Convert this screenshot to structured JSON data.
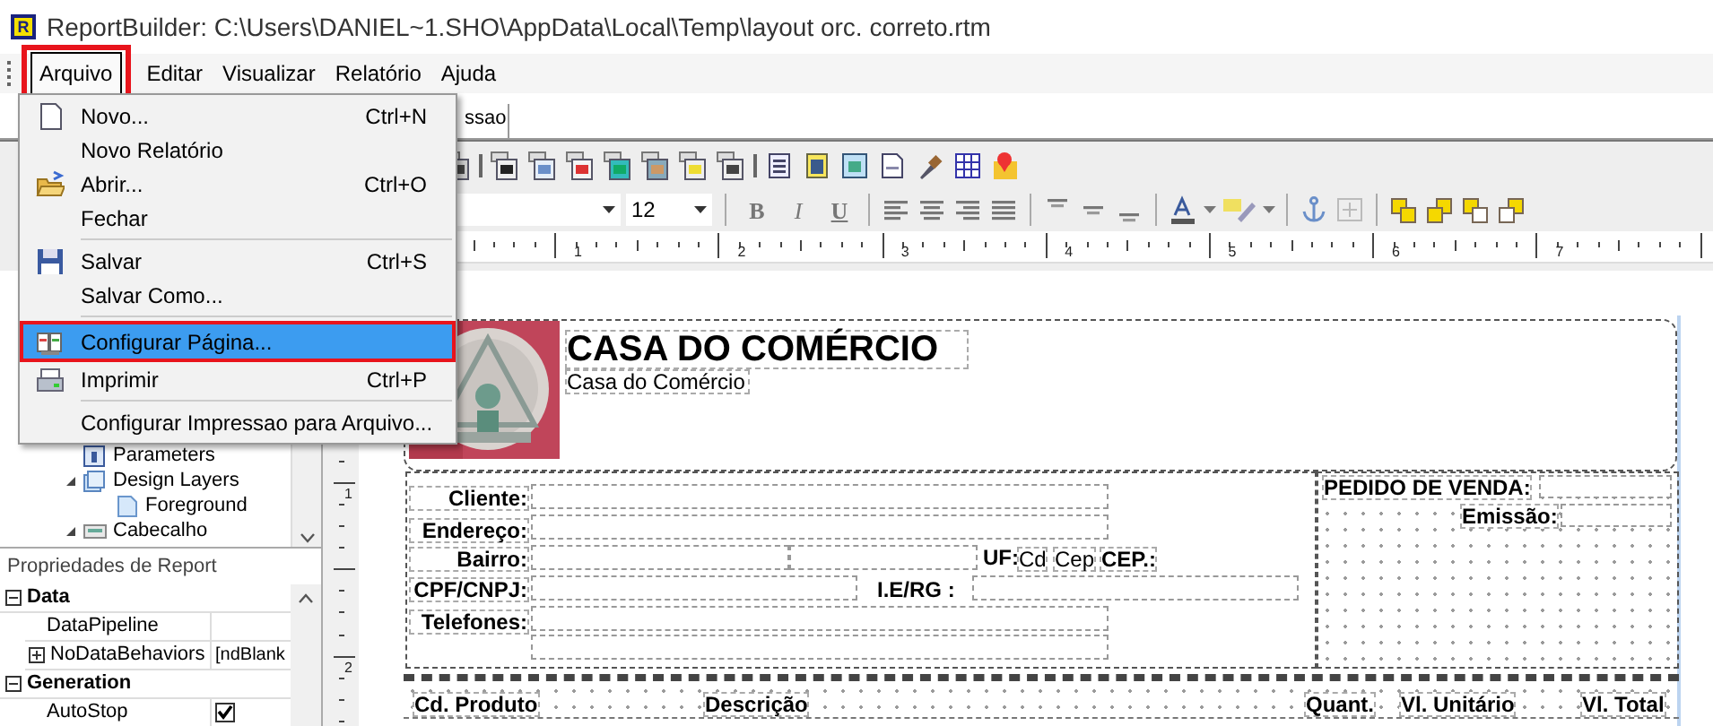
{
  "window": {
    "logo_letter": "R",
    "title": "ReportBuilder: C:\\Users\\DANIEL~1.SHO\\AppData\\Local\\Temp\\layout orc. correto.rtm"
  },
  "menu_bar": [
    {
      "label": "Arquivo",
      "selected": true,
      "outlined": true
    },
    {
      "label": "Editar",
      "selected": false,
      "outlined": false
    },
    {
      "label": "Visualizar",
      "selected": false,
      "outlined": false
    },
    {
      "label": "Relatório",
      "selected": false,
      "outlined": false
    },
    {
      "label": "Ajuda",
      "selected": false,
      "outlined": false
    }
  ],
  "tabs": [
    {
      "label": "ssao"
    }
  ],
  "file_menu": [
    {
      "kind": "item",
      "label": "Novo...",
      "shortcut": "Ctrl+N",
      "selected": false,
      "outlined": false
    },
    {
      "kind": "item",
      "label": "Novo Relatório",
      "selected": false,
      "outlined": false
    },
    {
      "kind": "item",
      "label": "Abrir...",
      "shortcut": "Ctrl+O",
      "selected": false,
      "outlined": false
    },
    {
      "kind": "item",
      "label": "Fechar",
      "selected": false,
      "outlined": false
    },
    {
      "kind": "separator"
    },
    {
      "kind": "item",
      "label": "Salvar",
      "shortcut": "Ctrl+S",
      "selected": false,
      "outlined": false
    },
    {
      "kind": "item",
      "label": "Salvar Como...",
      "selected": false,
      "outlined": false
    },
    {
      "kind": "separator"
    },
    {
      "kind": "item",
      "label": "Configurar Página...",
      "selected": true,
      "outlined": true
    },
    {
      "kind": "item",
      "label": "Imprimir",
      "shortcut": "Ctrl+P",
      "selected": false,
      "outlined": false
    },
    {
      "kind": "separator"
    },
    {
      "kind": "item",
      "label": "Configurar Impressao para Arquivo...",
      "selected": false,
      "outlined": false
    }
  ],
  "toolbar": {
    "font_size": "12",
    "format_buttons": [
      "B",
      "I",
      "U"
    ]
  },
  "ruler": {
    "marks": [
      "1",
      "2",
      "3",
      "4",
      "5",
      "6",
      "7"
    ]
  },
  "vertical_ruler": {
    "marks": [
      "1",
      "2"
    ]
  },
  "report_tree": [
    {
      "label": "Parameters"
    },
    {
      "label": "Design Layers",
      "expanded": true,
      "children": [
        {
          "label": "Foreground"
        }
      ]
    },
    {
      "label": "Cabecalho",
      "expanded": true
    }
  ],
  "properties": {
    "title": "Propriedades de Report",
    "groups": [
      {
        "name": "Data",
        "expanded": true,
        "rows": [
          {
            "name": "DataPipeline"
          },
          {
            "name": "NoDataBehaviors",
            "value": "[ndBlank",
            "expandable": true
          }
        ]
      },
      {
        "name": "Generation",
        "expanded": true,
        "rows": [
          {
            "name": "AutoStop",
            "kind": "checkbox",
            "checked": true
          }
        ]
      }
    ]
  },
  "report": {
    "title": "CASA DO COMÉRCIO",
    "subtitle": "Casa do Comércio",
    "customer_labels": [
      "Cliente:",
      "Endereço:",
      "Bairro:",
      "CPF/CNPJ:",
      "Telefones:"
    ],
    "uf_label": "UF:",
    "city_field": "Cd",
    "cep_field": "Cep",
    "cep_label": "CEP.:",
    "ie_label": "I.E/RG :",
    "order_label": "PEDIDO DE VENDA:",
    "issue_label": "Emissão:",
    "columns": [
      "Cd. Produto",
      "Descrição",
      "Quant.",
      "Vl. Unitário",
      "Vl. Total"
    ]
  }
}
